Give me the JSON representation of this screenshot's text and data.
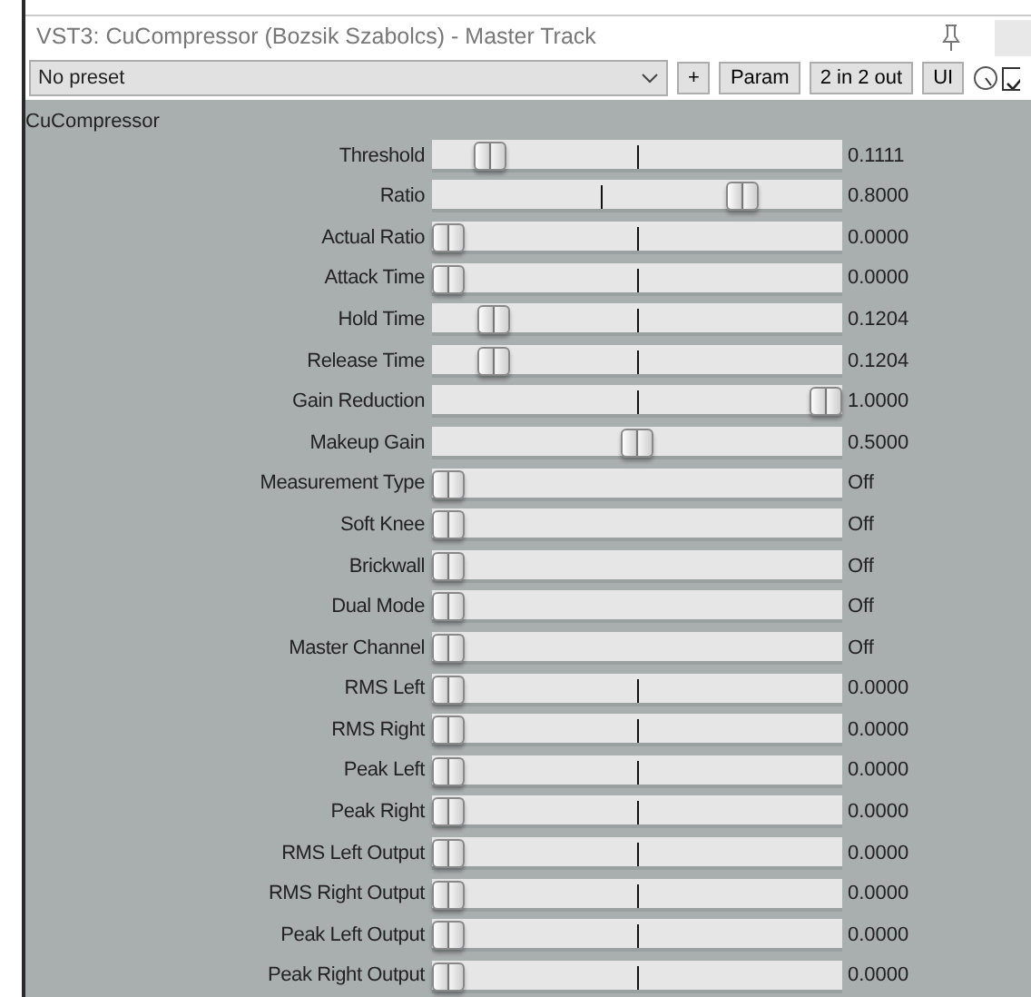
{
  "window": {
    "title": "VST3: CuCompressor (Bozsik Szabolcs) - Master Track"
  },
  "toolbar": {
    "preset": "No preset",
    "buttons": [
      "+",
      "Param",
      "2 in 2 out",
      "UI"
    ],
    "bypass_checked": true
  },
  "plugin_name": "CuCompressor",
  "parameters": [
    {
      "name": "Threshold",
      "kind": "slider",
      "level": 0.11,
      "default_marker": {
        "level": 0.5
      },
      "value": "0.1111"
    },
    {
      "name": "Ratio",
      "kind": "slider",
      "level": 0.78,
      "default_marker": {
        "level": 0.41
      },
      "value": "0.8000"
    },
    {
      "name": "Actual Ratio",
      "kind": "slider",
      "level": 0,
      "default_marker": {
        "level": 0.5
      },
      "value": "0.0000"
    },
    {
      "name": "Attack Time",
      "kind": "slider",
      "level": 0,
      "default_marker": {
        "level": 0.5
      },
      "value": "0.0000"
    },
    {
      "name": "Hold Time",
      "kind": "slider",
      "level": 0.12,
      "default_marker": {
        "level": 0.5
      },
      "value": "0.1204"
    },
    {
      "name": "Release Time",
      "kind": "slider",
      "level": 0.12,
      "default_marker": {
        "level": 0.5
      },
      "value": "0.1204"
    },
    {
      "name": "Gain Reduction",
      "kind": "slider",
      "level": 1,
      "default_marker": {
        "level": 0.5
      },
      "value": "1.0000"
    },
    {
      "name": "Makeup Gain",
      "kind": "slider",
      "level": 0.5,
      "default_marker": {
        "level": 0.5
      },
      "value": "0.5000"
    },
    {
      "name": "Measurement Type",
      "kind": "toggle",
      "level": 0,
      "value": "Off"
    },
    {
      "name": "Soft Knee",
      "kind": "toggle",
      "level": 0,
      "value": "Off"
    },
    {
      "name": "Brickwall",
      "kind": "toggle",
      "level": 0,
      "value": "Off"
    },
    {
      "name": "Dual Mode",
      "kind": "toggle",
      "level": 0,
      "value": "Off"
    },
    {
      "name": "Master Channel",
      "kind": "toggle",
      "level": 0,
      "value": "Off"
    },
    {
      "name": "RMS Left",
      "kind": "slider",
      "level": 0,
      "default_marker": {
        "level": 0.5
      },
      "value": "0.0000"
    },
    {
      "name": "RMS Right",
      "kind": "slider",
      "level": 0,
      "default_marker": {
        "level": 0.5
      },
      "value": "0.0000"
    },
    {
      "name": "Peak Left",
      "kind": "slider",
      "level": 0,
      "default_marker": {
        "level": 0.5
      },
      "value": "0.0000"
    },
    {
      "name": "Peak Right",
      "kind": "slider",
      "level": 0,
      "default_marker": {
        "level": 0.5
      },
      "value": "0.0000"
    },
    {
      "name": "RMS Left Output",
      "kind": "slider",
      "level": 0,
      "default_marker": {
        "level": 0.5
      },
      "value": "0.0000"
    },
    {
      "name": "RMS Right Output",
      "kind": "slider",
      "level": 0,
      "default_marker": {
        "level": 0.5
      },
      "value": "0.0000"
    },
    {
      "name": "Peak Left Output",
      "kind": "slider",
      "level": 0,
      "default_marker": {
        "level": 0.5
      },
      "value": "0.0000"
    },
    {
      "name": "Peak Right Output",
      "kind": "slider",
      "level": 0,
      "default_marker": {
        "level": 0.5
      },
      "value": "0.0000"
    }
  ]
}
